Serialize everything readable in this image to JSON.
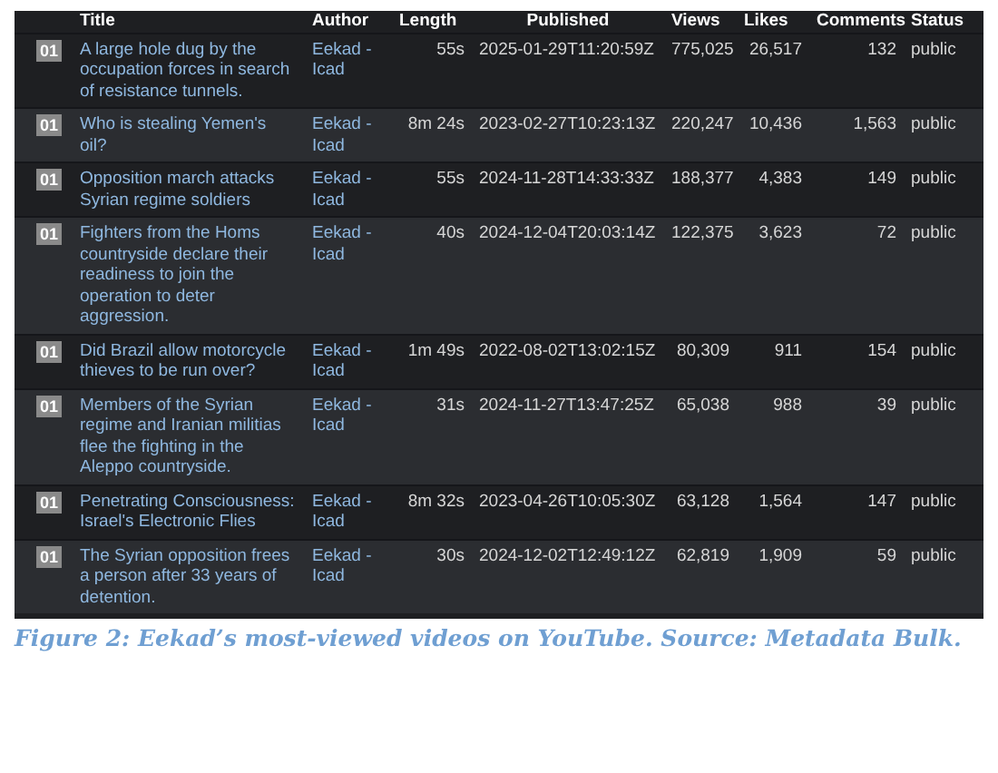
{
  "table": {
    "columns": [
      "Title",
      "Author",
      "Length",
      "Published",
      "Views",
      "Likes",
      "Comments",
      "Status"
    ],
    "rows": [
      {
        "rank": "01",
        "title": "A large hole dug by the occupation forces in search of resistance tunnels.",
        "author": "Eekad - Icad",
        "length": "55s",
        "published": "2025-01-29T11:20:59Z",
        "views": "775,025",
        "likes": "26,517",
        "comments": "132",
        "status": "public"
      },
      {
        "rank": "01",
        "title": "Who is stealing Yemen's oil?",
        "author": "Eekad - Icad",
        "length": "8m 24s",
        "published": "2023-02-27T10:23:13Z",
        "views": "220,247",
        "likes": "10,436",
        "comments": "1,563",
        "status": "public"
      },
      {
        "rank": "01",
        "title": "Opposition march attacks Syrian regime soldiers",
        "author": "Eekad - Icad",
        "length": "55s",
        "published": "2024-11-28T14:33:33Z",
        "views": "188,377",
        "likes": "4,383",
        "comments": "149",
        "status": "public"
      },
      {
        "rank": "01",
        "title": "Fighters from the Homs countryside declare their readiness to join the operation to deter aggression.",
        "author": "Eekad - Icad",
        "length": "40s",
        "published": "2024-12-04T20:03:14Z",
        "views": "122,375",
        "likes": "3,623",
        "comments": "72",
        "status": "public"
      },
      {
        "rank": "01",
        "title": "Did Brazil allow motorcycle thieves to be run over?",
        "author": "Eekad - Icad",
        "length": "1m 49s",
        "published": "2022-08-02T13:02:15Z",
        "views": "80,309",
        "likes": "911",
        "comments": "154",
        "status": "public"
      },
      {
        "rank": "01",
        "title": "Members of the Syrian regime and Iranian militias flee the fighting in the Aleppo countryside.",
        "author": "Eekad - Icad",
        "length": "31s",
        "published": "2024-11-27T13:47:25Z",
        "views": "65,038",
        "likes": "988",
        "comments": "39",
        "status": "public"
      },
      {
        "rank": "01",
        "title": "Penetrating Consciousness: Israel's Electronic Flies",
        "author": "Eekad - Icad",
        "length": "8m 32s",
        "published": "2023-04-26T10:05:30Z",
        "views": "63,128",
        "likes": "1,564",
        "comments": "147",
        "status": "public"
      },
      {
        "rank": "01",
        "title": "The Syrian opposition frees a person after 33 years of detention.",
        "author": "Eekad - Icad",
        "length": "30s",
        "published": "2024-12-02T12:49:12Z",
        "views": "62,819",
        "likes": "1,909",
        "comments": "59",
        "status": "public"
      }
    ]
  },
  "caption": "Figure 2: Eekad’s most-viewed videos on YouTube. Source: Metadata Bulk."
}
